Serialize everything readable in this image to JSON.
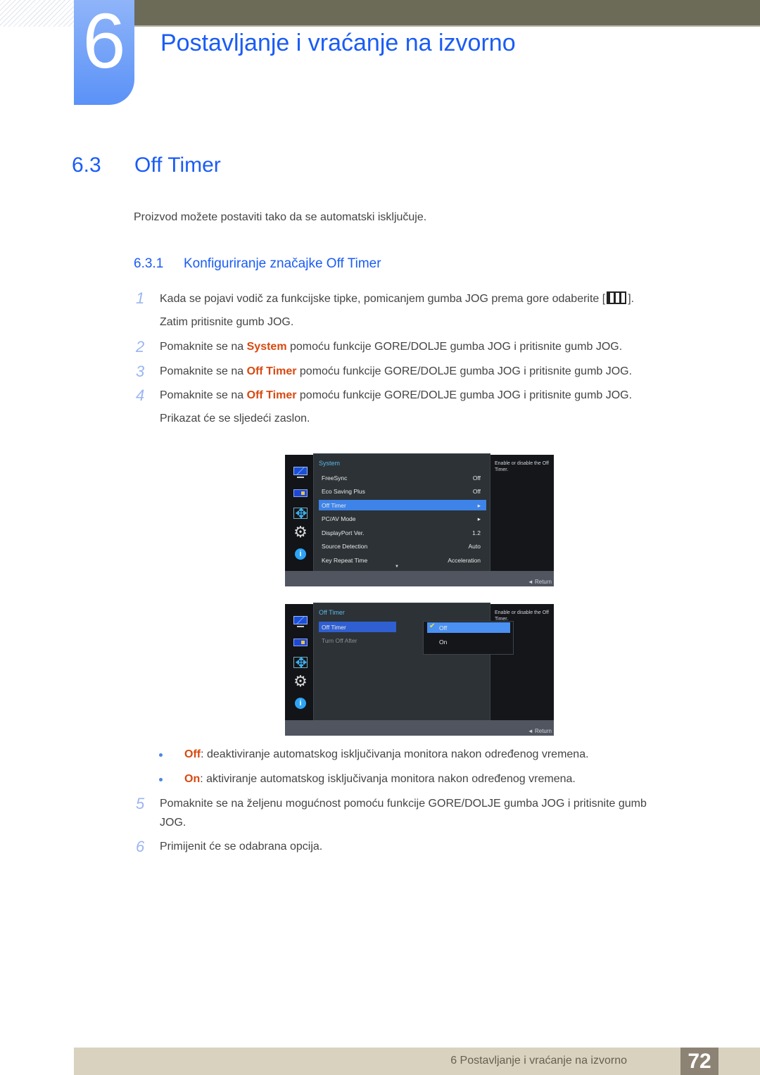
{
  "header": {
    "chapter_number": "6",
    "chapter_title": "Postavljanje i vraćanje na izvorno"
  },
  "section": {
    "number": "6.3",
    "title": "Off Timer",
    "intro": "Proizvod možete postaviti tako da se automatski isključuje."
  },
  "subsection": {
    "number": "6.3.1",
    "title": "Konfiguriranje značajke Off Timer"
  },
  "steps": [
    {
      "n": "1",
      "pre": "Kada se pojavi vodič za funkcijske tipke, pomicanjem gumba JOG prema gore odaberite [",
      "icon": "menu-icon",
      "post": "].",
      "line2": "Zatim pritisnite gumb JOG."
    },
    {
      "n": "2",
      "pre": "Pomaknite se na ",
      "hl": "System",
      "post": " pomoću funkcije GORE/DOLJE gumba JOG i pritisnite gumb JOG."
    },
    {
      "n": "3",
      "pre": "Pomaknite se na ",
      "hl": "Off Timer",
      "post": " pomoću funkcije GORE/DOLJE gumba JOG i pritisnite gumb JOG."
    },
    {
      "n": "4",
      "pre": "Pomaknite se na ",
      "hl": "Off Timer",
      "post": " pomoću funkcije GORE/DOLJE gumba JOG i pritisnite gumb JOG.",
      "line2": "Prikazat će se sljedeći zaslon."
    },
    {
      "n": "5",
      "text": "Pomaknite se na željenu mogućnost pomoću funkcije GORE/DOLJE gumba JOG i pritisnite gumb",
      "line2": "JOG."
    },
    {
      "n": "6",
      "text": "Primijenit će se odabrana opcija."
    }
  ],
  "osd1": {
    "panel_title": "System",
    "rows": [
      {
        "label": "FreeSync",
        "value": "Off"
      },
      {
        "label": "Eco Saving Plus",
        "value": "Off"
      },
      {
        "label": "Off Timer",
        "value": "▸",
        "selected": true
      },
      {
        "label": "PC/AV Mode",
        "value": "▸"
      },
      {
        "label": "DisplayPort Ver.",
        "value": "1.2"
      },
      {
        "label": "Source Detection",
        "value": "Auto"
      },
      {
        "label": "Key Repeat Time",
        "value": "Acceleration"
      }
    ],
    "scroll_arrow": "▼",
    "help": "Enable or disable the Off Timer.",
    "return_label": "◄  Return"
  },
  "osd2": {
    "panel_title": "Off Timer",
    "rows": [
      {
        "label": "Off Timer",
        "selected": true
      },
      {
        "label": "Turn Off After",
        "dim": true
      }
    ],
    "options": [
      {
        "label": "Off",
        "checked": true
      },
      {
        "label": "On",
        "checked": false
      }
    ],
    "check_glyph": "✔",
    "help": "Enable or disable the Off Timer.",
    "return_label": "◄  Return"
  },
  "sidebar_icons": {
    "gear": "⚙",
    "info": "i"
  },
  "bullets": [
    {
      "key": "Off",
      "text": ": deaktiviranje automatskog isključivanja monitora nakon određenog vremena."
    },
    {
      "key": "On",
      "text": ": aktiviranje automatskog isključivanja monitora nakon određenog vremena."
    }
  ],
  "footer": {
    "text": "6 Postavljanje i vraćanje na izvorno",
    "page": "72"
  },
  "colors": {
    "accent_blue": "#1a5cf5",
    "highlight_orange": "#d9480f",
    "osd_selection": "#3d83e8",
    "header_bar": "#6c6b58",
    "footer_bg": "#d8d2bf"
  }
}
